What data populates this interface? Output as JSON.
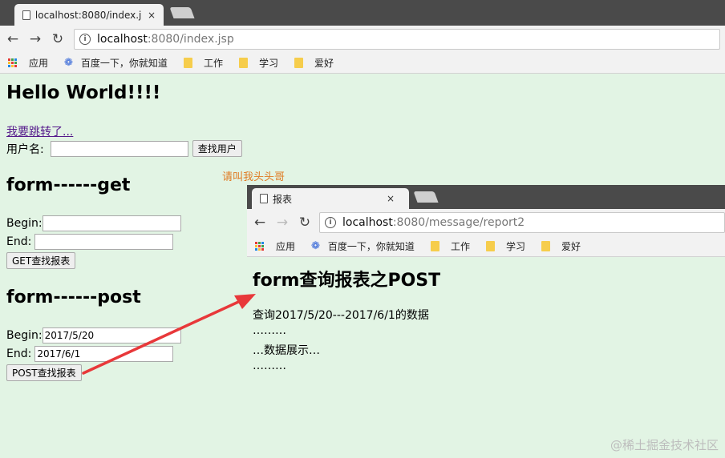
{
  "window1": {
    "tab_title": "localhost:8080/index.jsp",
    "tab_close": "×",
    "url_host": "localhost",
    "url_rest": ":8080/index.jsp",
    "bookmarks": [
      "应用",
      "百度一下，你就知道",
      "工作",
      "学习",
      "爱好"
    ]
  },
  "page": {
    "heading": "Hello World!!!!",
    "link": "我要跳转了...",
    "username_label": "用户名:",
    "find_user_button": "查找用户",
    "get_section_title": "form------get",
    "begin_label": "Begin:",
    "end_label": "End:",
    "get_button": "GET查找报表",
    "post_section_title": "form------post",
    "post_begin_value": "2017/5/20",
    "post_end_value": "2017/6/1",
    "post_button": "POST查找报表"
  },
  "annotation": "请叫我头头哥",
  "window2": {
    "tab_title": "报表",
    "tab_close": "×",
    "url_host": "localhost",
    "url_rest": ":8080/message/report2",
    "bookmarks": [
      "应用",
      "百度一下，你就知道",
      "工作",
      "学习",
      "爱好"
    ],
    "title": "form查询报表之POST",
    "lines": [
      "查询2017/5/20---2017/6/1的数据",
      "………",
      "…数据展示…",
      "………"
    ]
  },
  "watermark": "@稀土掘金技术社区",
  "colors": {
    "page_bg": "#e2f4e4",
    "arrow": "#e8383a",
    "annotation": "#e07a22",
    "link": "#551a8b"
  }
}
